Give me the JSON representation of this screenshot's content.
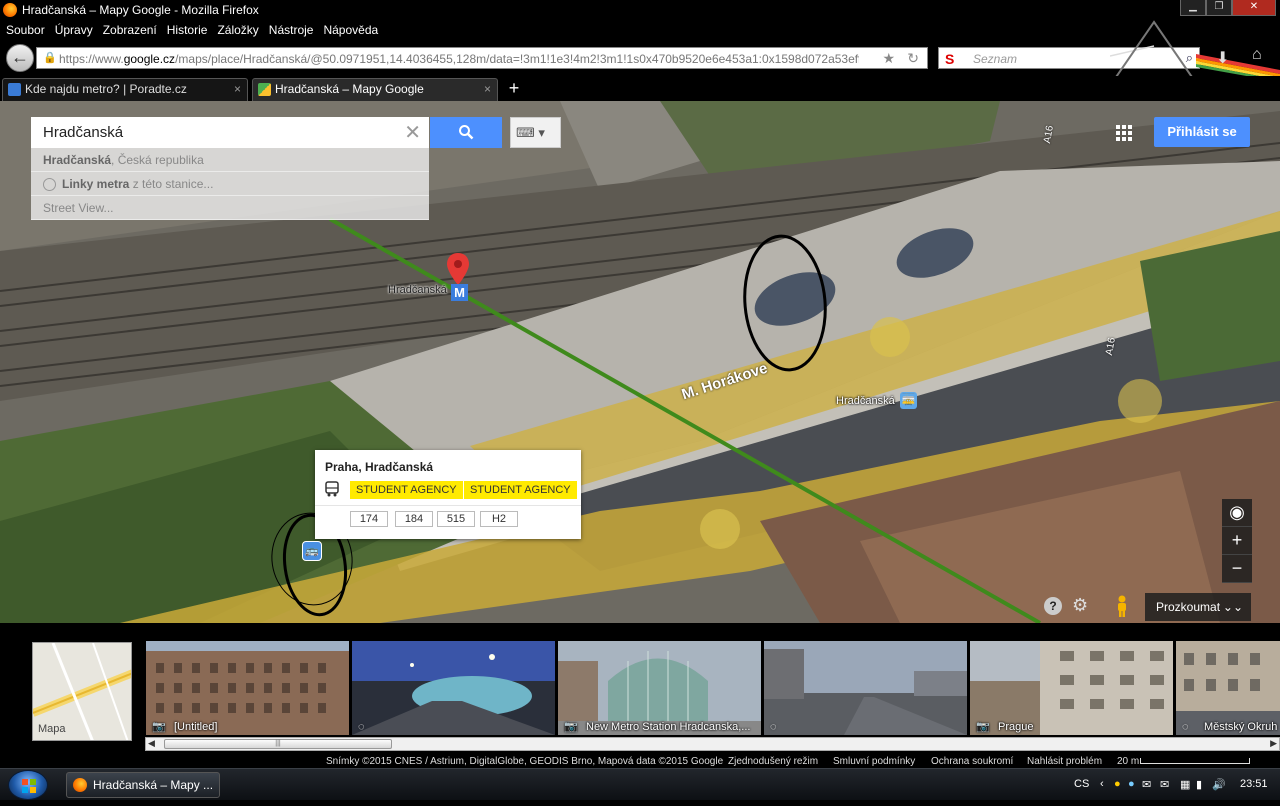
{
  "window": {
    "title": "Hradčanská – Mapy Google - Mozilla Firefox",
    "minimize": "▁",
    "maximize": "❐",
    "close": "✕"
  },
  "menu": [
    "Soubor",
    "Úpravy",
    "Zobrazení",
    "Historie",
    "Záložky",
    "Nástroje",
    "Nápověda"
  ],
  "nav": {
    "url_prefix": "https://www.",
    "url_domain": "google.cz",
    "url_rest": "/maps/place/Hradčanská/@50.0971951,14.4036455,128m/data=!3m1!1e3!4m2!3m1!1s0x470b9520e6e453a1:0x1598d072a53eff9f?hl=c",
    "search_placeholder": "Seznam",
    "search_logo": "S"
  },
  "tabs": [
    {
      "label": "Kde najdu metro? | Poradte.cz",
      "icon_color": "#3a7bd5"
    },
    {
      "label": "Hradčanská – Mapy Google",
      "icon_color": "#4caf50"
    }
  ],
  "map": {
    "search_query": "Hradčanská",
    "suggestions": {
      "s1_bold": "Hradčanská",
      "s1_rest": ", Česká republika",
      "s2_bold": "Linky metra",
      "s2_rest": " z této stanice...",
      "s3": "Street View..."
    },
    "signin": "Přihlásit se",
    "pin_label": "Hradčanská",
    "metro_letter": "M",
    "street_label": "M. Horákove",
    "station_label": "Hradčanská",
    "road_marker": "A16",
    "infocard": {
      "title": "Praha, Hradčanská",
      "agencies": [
        "STUDENT AGENCY",
        "STUDENT AGENCY"
      ],
      "routes": [
        "174",
        "184",
        "515",
        "H2"
      ]
    },
    "explore_label": "Prozkoumat"
  },
  "strip": {
    "mini_map_label": "Mapa",
    "photos": [
      {
        "caption": "[Untitled]",
        "kind": "camera-icon"
      },
      {
        "caption": "",
        "kind": "panorama-icon"
      },
      {
        "caption": "New Metro Station Hradcanska,...",
        "kind": "camera-icon"
      },
      {
        "caption": "",
        "kind": "panorama-icon"
      },
      {
        "caption": "Prague",
        "kind": "camera-icon"
      },
      {
        "caption": "Městský Okruh",
        "kind": "panorama-icon"
      }
    ]
  },
  "footer": {
    "credits": "Snímky ©2015 CNES / Astrium, DigitalGlobe, GEODIS Brno, Mapová data ©2015 Google",
    "simple_mode": "Zjednodušený režim",
    "terms": "Smluvní podmínky",
    "privacy": "Ochrana soukromí",
    "report": "Nahlásit problém",
    "scale": "20 m"
  },
  "taskbar": {
    "task_label": "Hradčanská – Mapy ...",
    "lang": "CS",
    "time": "23:51"
  }
}
